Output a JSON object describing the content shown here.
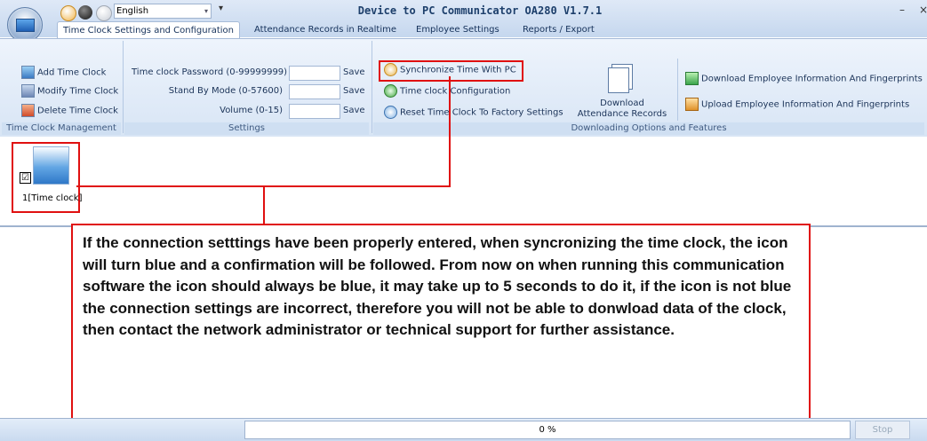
{
  "window": {
    "title": "Device to PC Communicator OA280 V1.7.1",
    "language": "English",
    "minimize": "–",
    "close": "×"
  },
  "tabs": [
    {
      "label": "Time Clock Settings and Configuration",
      "active": true
    },
    {
      "label": "Attendance Records in Realtime",
      "active": false
    },
    {
      "label": "Employee Settings",
      "active": false
    },
    {
      "label": "Reports / Export",
      "active": false
    }
  ],
  "ribbon": {
    "management": {
      "label": "Time Clock Management",
      "buttons": [
        "Add Time Clock",
        "Modify Time Clock",
        "Delete Time Clock"
      ],
      "icons": [
        "add-clock-icon",
        "modify-clock-icon",
        "delete-clock-icon"
      ]
    },
    "settings": {
      "label": "Settings",
      "fields": [
        {
          "label": "Time clock Password (0-99999999)",
          "value": "",
          "save": "Save"
        },
        {
          "label": "Stand By Mode (0-57600)",
          "value": "",
          "save": "Save"
        },
        {
          "label": "Volume (0-15)",
          "value": "",
          "save": "Save"
        }
      ]
    },
    "downloading": {
      "label": "Downloading Options and Features",
      "sync": "Synchronize Time With PC",
      "config": "Time clock Configuration",
      "reset": "Reset Time Clock To Factory Settings",
      "download_records_line1": "Download",
      "download_records_line2": "Attendance Records",
      "download_employee": "Download Employee Information And Fingerprints",
      "upload_employee": "Upload Employee Information And Fingerprints"
    }
  },
  "device": {
    "label": "1[Time clock]",
    "checked": true,
    "check_mark": "☑"
  },
  "callout": {
    "text": "If the connection setttings have been properly entered, when syncronizing the time clock, the icon will turn blue and a confirmation will be followed. From now on when running this communication software the icon should always be blue, it may take up to 5 seconds to do it, if the icon is not blue the connection settings are incorrect, therefore you will not be able to donwload data of the clock, then contact the network administrator or technical support for further assistance."
  },
  "status": {
    "progress_text": "0 %",
    "stop": "Stop"
  },
  "colors": {
    "accent_red": "#e01010",
    "ribbon_blue": "#d8e5f5"
  }
}
